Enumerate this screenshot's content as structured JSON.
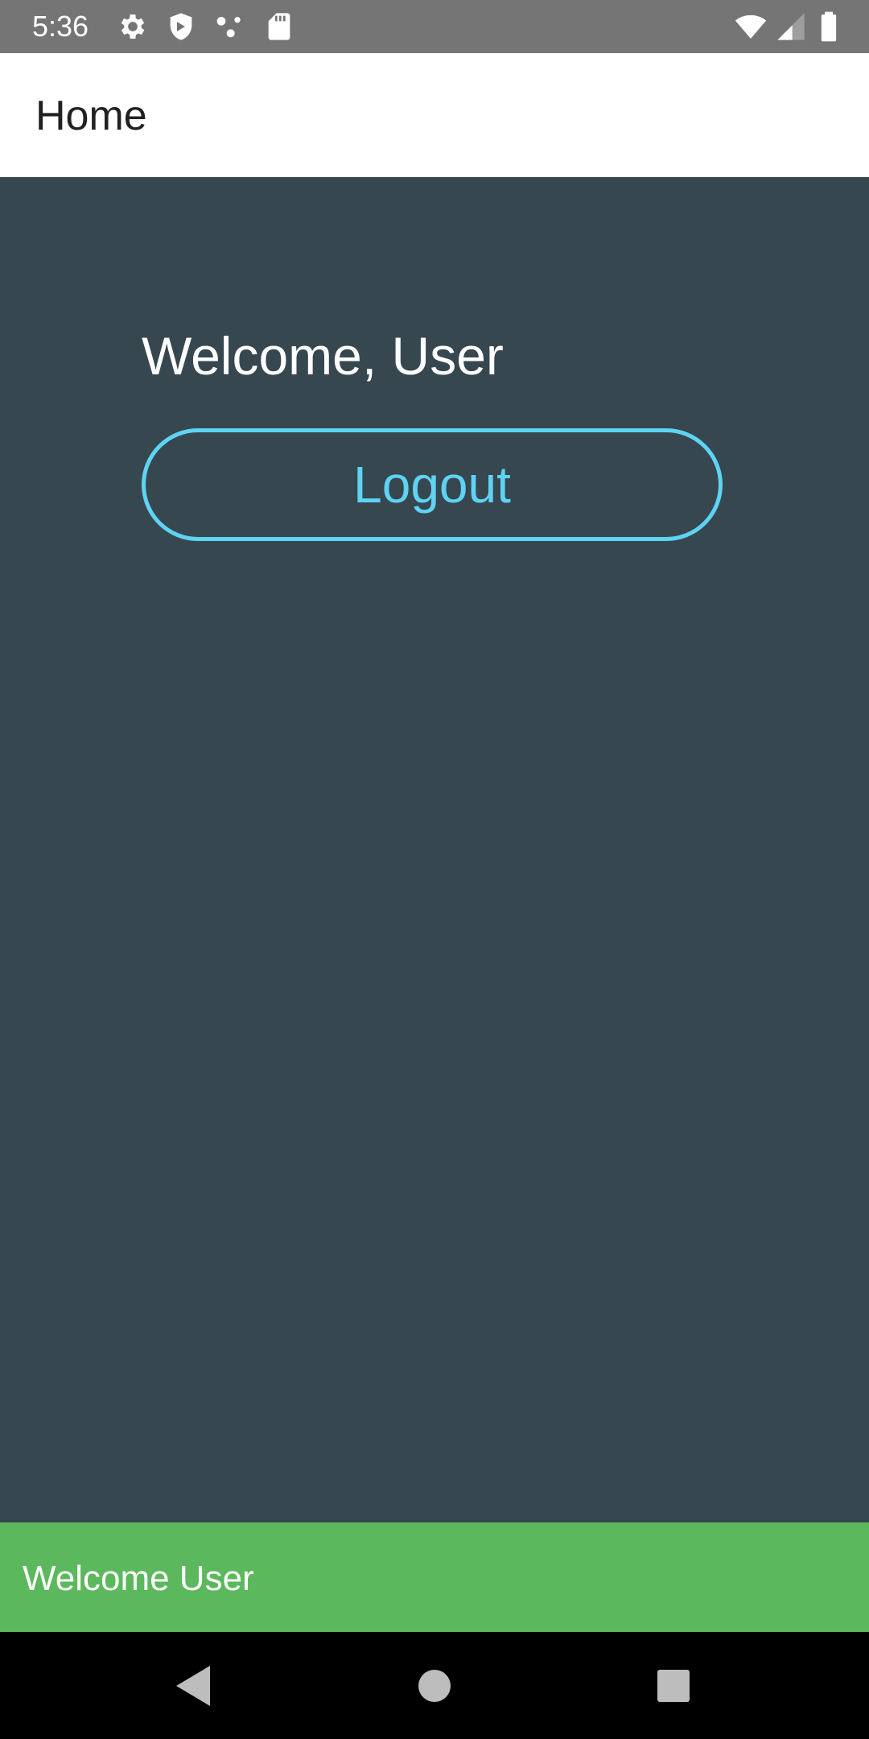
{
  "status_bar": {
    "time": "5:36",
    "left_icons": [
      "settings-icon",
      "shield-icon",
      "dots-icon",
      "sd-card-icon"
    ],
    "right_icons": [
      "wifi-icon",
      "cell-signal-icon",
      "battery-icon"
    ]
  },
  "app_bar": {
    "title": "Home"
  },
  "main": {
    "welcome_text": "Welcome, User",
    "logout_label": "Logout"
  },
  "snackbar": {
    "message": "Welcome User"
  },
  "nav_bar": {
    "buttons": [
      "back-icon",
      "home-icon",
      "recents-icon"
    ]
  },
  "colors": {
    "status_bar": "#757575",
    "app_bar": "#ffffff",
    "background": "#37474f",
    "accent": "#5fd3f3",
    "snackbar": "#5cb85c",
    "nav_bar": "#000000"
  }
}
